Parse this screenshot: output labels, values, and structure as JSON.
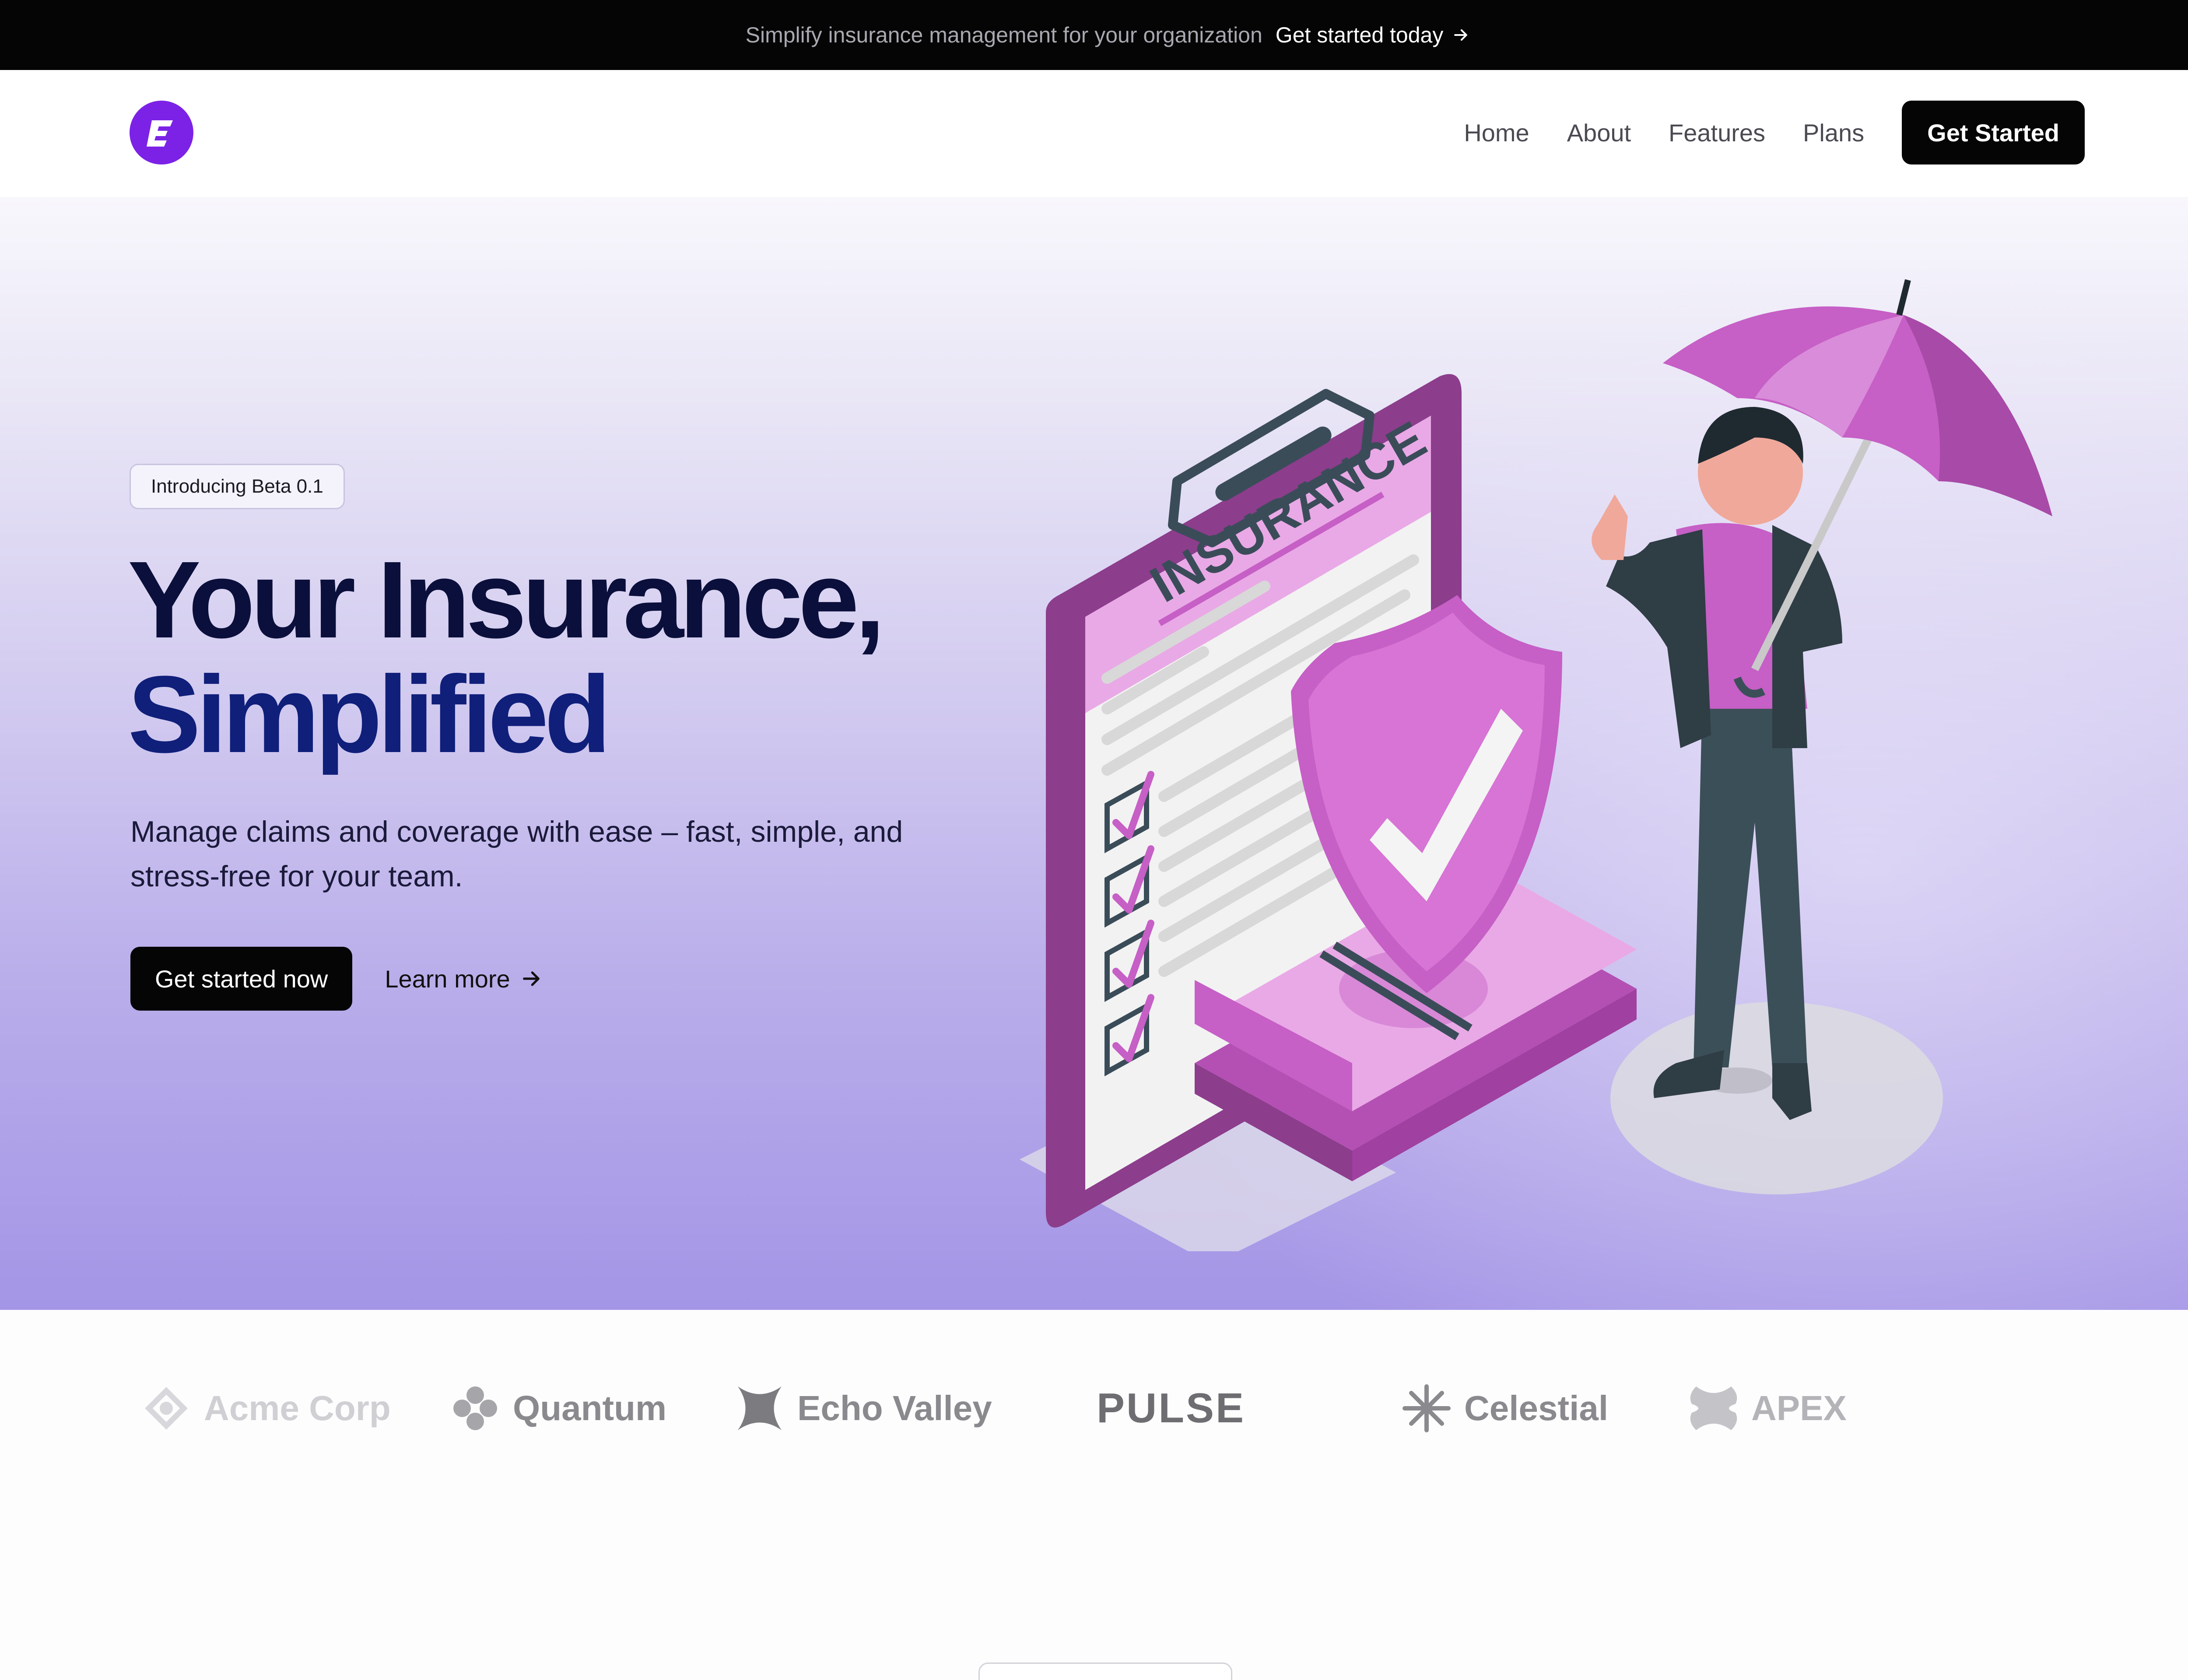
{
  "announcement": {
    "message": "Simplify insurance management for your organization",
    "cta_label": "Get started today"
  },
  "header": {
    "logo_icon": "brand-e-logo",
    "nav": [
      {
        "label": "Home"
      },
      {
        "label": "About"
      },
      {
        "label": "Features"
      },
      {
        "label": "Plans"
      }
    ],
    "cta_label": "Get Started"
  },
  "hero": {
    "badge": "Introducing Beta 0.1",
    "title_line1": "Your Insurance,",
    "title_line2": "Simplified",
    "subtitle": "Manage claims and coverage with ease – fast, simple, and stress-free for your team.",
    "primary_cta": "Get started now",
    "secondary_cta": "Learn more",
    "illustration_text": "INSURANCE"
  },
  "logos": [
    {
      "name": "Acme Corp",
      "icon": "acme-icon"
    },
    {
      "name": "Quantum",
      "icon": "quantum-icon"
    },
    {
      "name": "Echo Valley",
      "icon": "echo-valley-icon"
    },
    {
      "name": "PULSE",
      "icon": "pulse-wordmark"
    },
    {
      "name": "Celestial",
      "icon": "celestial-icon"
    },
    {
      "name": "APEX",
      "icon": "apex-icon"
    }
  ],
  "colors": {
    "brand": "#7c22e6",
    "dark": "#050505",
    "title_dark": "#0b0f3b",
    "title_blue": "#0f1f7a",
    "illustration_purple": "#c65fc6"
  }
}
